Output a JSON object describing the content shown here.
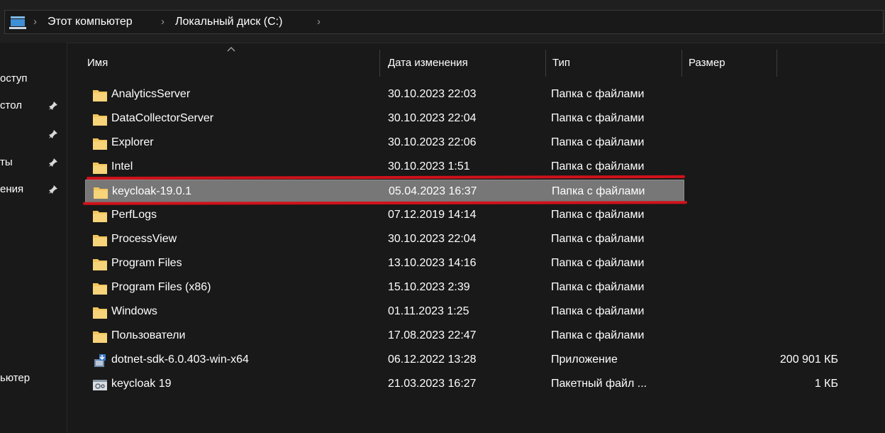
{
  "address_bar": {
    "crumbs": [
      "Этот компьютер",
      "Локальный диск (C:)"
    ]
  },
  "nav_pane": {
    "items": [
      {
        "label": "оступ",
        "pinned": false
      },
      {
        "label": "стол",
        "pinned": true
      },
      {
        "label": "",
        "pinned": true
      },
      {
        "label": "ты",
        "pinned": true
      },
      {
        "label": "ения",
        "pinned": true
      },
      {
        "label": "ьютер",
        "pinned": false
      }
    ]
  },
  "columns": {
    "name": "Имя",
    "date": "Дата изменения",
    "type": "Тип",
    "size": "Размер"
  },
  "files": [
    {
      "name": "AnalyticsServer",
      "date": "30.10.2023 22:03",
      "type": "Папка с файлами",
      "size": "",
      "icon": "folder-icon"
    },
    {
      "name": "DataCollectorServer",
      "date": "30.10.2023 22:04",
      "type": "Папка с файлами",
      "size": "",
      "icon": "folder-icon"
    },
    {
      "name": "Explorer",
      "date": "30.10.2023 22:06",
      "type": "Папка с файлами",
      "size": "",
      "icon": "folder-icon"
    },
    {
      "name": "Intel",
      "date": "30.10.2023 1:51",
      "type": "Папка с файлами",
      "size": "",
      "icon": "folder-icon"
    },
    {
      "name": "keycloak-19.0.1",
      "date": "05.04.2023 16:37",
      "type": "Папка с файлами",
      "size": "",
      "icon": "folder-icon",
      "selected": true
    },
    {
      "name": "PerfLogs",
      "date": "07.12.2019 14:14",
      "type": "Папка с файлами",
      "size": "",
      "icon": "folder-icon"
    },
    {
      "name": "ProcessView",
      "date": "30.10.2023 22:04",
      "type": "Папка с файлами",
      "size": "",
      "icon": "folder-icon"
    },
    {
      "name": "Program Files",
      "date": "13.10.2023 14:16",
      "type": "Папка с файлами",
      "size": "",
      "icon": "folder-icon"
    },
    {
      "name": "Program Files (x86)",
      "date": "15.10.2023 2:39",
      "type": "Папка с файлами",
      "size": "",
      "icon": "folder-icon"
    },
    {
      "name": "Windows",
      "date": "01.11.2023 1:25",
      "type": "Папка с файлами",
      "size": "",
      "icon": "folder-icon"
    },
    {
      "name": "Пользователи",
      "date": "17.08.2023 22:47",
      "type": "Папка с файлами",
      "size": "",
      "icon": "folder-icon"
    },
    {
      "name": "dotnet-sdk-6.0.403-win-x64",
      "date": "06.12.2022 13:28",
      "type": "Приложение",
      "size": "200 901 КБ",
      "icon": "installer-icon"
    },
    {
      "name": "keycloak 19",
      "date": "21.03.2023 16:27",
      "type": "Пакетный файл ...",
      "size": "1 КБ",
      "icon": "batch-file-icon"
    }
  ],
  "colors": {
    "background": "#191919",
    "selection": "#777777",
    "folder": "#f2c55c",
    "annotation_red": "#d0121b"
  }
}
